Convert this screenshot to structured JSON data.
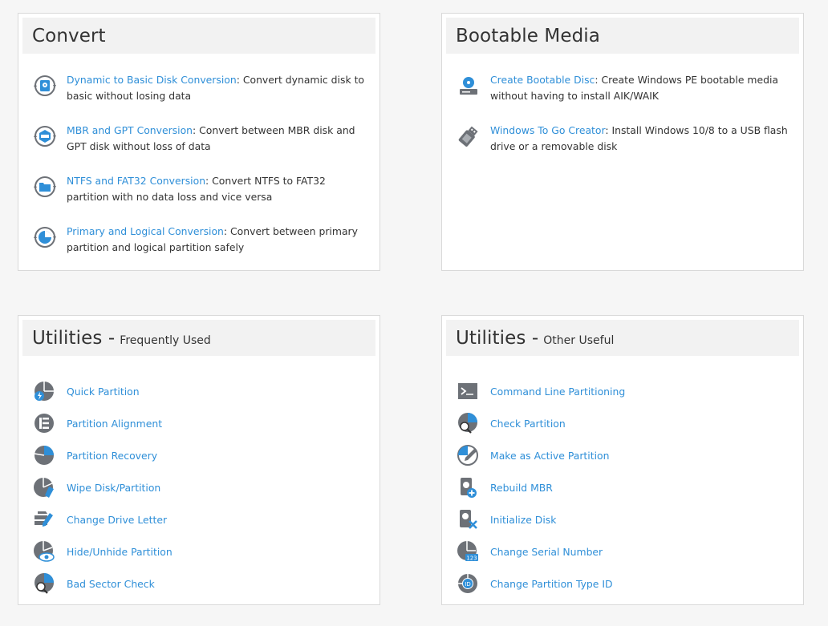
{
  "convert": {
    "title": "Convert",
    "items": [
      {
        "link": "Dynamic to Basic Disk Conversion",
        "desc": ": Convert dynamic disk to basic without losing data",
        "icon": "dynamic-basic-convert-icon"
      },
      {
        "link": "MBR and GPT Conversion",
        "desc": ": Convert between MBR disk and GPT disk without loss of data",
        "icon": "mbr-gpt-convert-icon"
      },
      {
        "link": "NTFS and FAT32 Conversion",
        "desc": ": Convert NTFS to FAT32 partition with no data loss and vice versa",
        "icon": "ntfs-fat32-convert-icon"
      },
      {
        "link": "Primary and Logical Conversion",
        "desc": ": Convert between primary partition and logical partition safely",
        "icon": "primary-logical-convert-icon"
      }
    ]
  },
  "bootable": {
    "title": "Bootable Media",
    "items": [
      {
        "link": "Create Bootable Disc",
        "desc": ": Create Windows PE bootable media without having to install AIK/WAIK",
        "icon": "bootable-disc-icon"
      },
      {
        "link": "Windows To Go Creator",
        "desc": ": Install Windows 10/8 to a USB flash drive or a removable disk",
        "icon": "usb-drive-icon"
      }
    ]
  },
  "utilities_frequent": {
    "title": "Utilities -",
    "subtitle": "Frequently Used",
    "items": [
      {
        "label": "Quick Partition",
        "icon": "quick-partition-icon"
      },
      {
        "label": "Partition Alignment",
        "icon": "partition-alignment-icon"
      },
      {
        "label": "Partition Recovery",
        "icon": "partition-recovery-icon"
      },
      {
        "label": "Wipe Disk/Partition",
        "icon": "wipe-disk-icon"
      },
      {
        "label": "Change Drive Letter",
        "icon": "change-drive-letter-icon"
      },
      {
        "label": "Hide/Unhide Partition",
        "icon": "hide-unhide-icon"
      },
      {
        "label": "Bad Sector Check",
        "icon": "bad-sector-check-icon"
      }
    ]
  },
  "utilities_other": {
    "title": "Utilities -",
    "subtitle": "Other Useful",
    "items": [
      {
        "label": "Command Line Partitioning",
        "icon": "command-line-icon"
      },
      {
        "label": "Check Partition",
        "icon": "check-partition-icon"
      },
      {
        "label": "Make as Active Partition",
        "icon": "active-partition-icon"
      },
      {
        "label": "Rebuild MBR",
        "icon": "rebuild-mbr-icon"
      },
      {
        "label": "Initialize Disk",
        "icon": "initialize-disk-icon"
      },
      {
        "label": "Change Serial Number",
        "icon": "serial-number-icon"
      },
      {
        "label": "Change Partition Type ID",
        "icon": "partition-type-id-icon"
      }
    ]
  },
  "colors": {
    "link": "#2f8fd8",
    "icon_gray": "#6d7177",
    "icon_blue": "#2f8fd8",
    "header_bg": "#f2f2f2"
  }
}
